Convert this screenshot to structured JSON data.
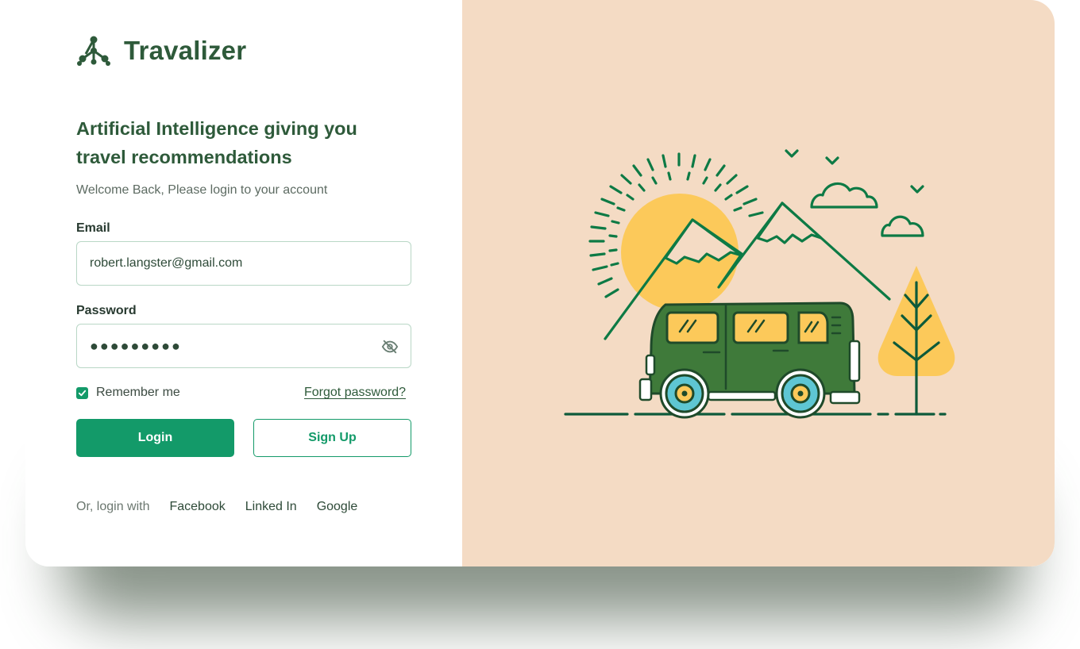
{
  "brand": {
    "name": "Travalizer",
    "icon": "network-nodes-icon",
    "color": "#2e5a3a"
  },
  "login": {
    "headline": "Artificial Intelligence giving you travel recommendations",
    "subtitle": "Welcome Back, Please login to your account",
    "email_label": "Email",
    "email_value": "robert.langster@gmail.com",
    "password_label": "Password",
    "password_value": "●●●●●●●●●",
    "password_toggle_icon": "eye-off-icon",
    "remember_label": "Remember me",
    "remember_checked": true,
    "forgot_label": "Forgot password?",
    "login_button": "Login",
    "signup_button": "Sign Up",
    "social_prefix": "Or, login with",
    "social_links": [
      "Facebook",
      "Linked In",
      "Google"
    ]
  },
  "colors": {
    "primary": "#139a69",
    "illustration_bg": "#f4dbc4",
    "van_body": "#3f7a3a",
    "sun": "#fcc95a",
    "wheel": "#5ec6d3",
    "line": "#0d6a3a"
  }
}
